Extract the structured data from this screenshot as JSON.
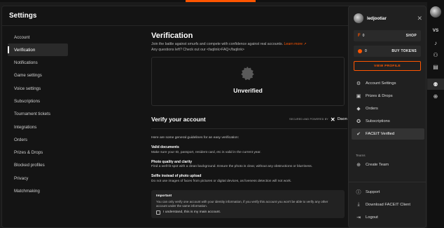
{
  "settings": {
    "title": "Settings",
    "nav": [
      {
        "label": "Account"
      },
      {
        "label": "Verification",
        "active": true
      },
      {
        "label": "Notifications"
      },
      {
        "label": "Game settings"
      },
      {
        "label": "Voice settings"
      },
      {
        "label": "Subscriptions"
      },
      {
        "label": "Tournament tickets"
      },
      {
        "label": "Integrations"
      },
      {
        "label": "Orders"
      },
      {
        "label": "Prizes & Drops"
      },
      {
        "label": "Blocked profiles"
      },
      {
        "label": "Privacy"
      },
      {
        "label": "Matchmaking"
      }
    ]
  },
  "verification": {
    "heading": "Verification",
    "lead_line1": "Join the battle against smurfs and compete with confidence against real accounts.",
    "learn_more": "Learn more ↗",
    "lead_line2": "Any questions left? Check out our <faqlink>FAQ</faqlink>",
    "status": "Unverified",
    "badge_icon": "verified-badge-icon"
  },
  "verify": {
    "heading": "Verify your account",
    "secured_label": "SECURED AND POWERED BY",
    "brand": "Daon",
    "intro": "Here are some general guidelines for an easy verification:",
    "guidelines": [
      {
        "title": "Valid documents",
        "text": "Make sure your ID, passport, resident card, etc is valid in the current year."
      },
      {
        "title": "Photo quality and clarity",
        "text": "Find a well-lit spot with a clean background. Ensure the photo is clear, without any obstructions or blurriness."
      },
      {
        "title": "Selfie instead of photo upload",
        "text": "Do not use images of faces from pictures or digital devices, as liveness detection will not work."
      }
    ],
    "important": {
      "title": "Important",
      "text": "You can only verify one account with your identity information, if you verify this account you won't be able to verify any other account under the same information.",
      "checkbox_label": "I understand, this is my main account."
    }
  },
  "menu": {
    "username": "ledjootiar",
    "points": {
      "amount": "0",
      "action": "SHOP"
    },
    "tokens": {
      "amount": "0",
      "action": "BUY TOKENS"
    },
    "view_profile": "VIEW PROFILE",
    "items": [
      {
        "label": "Account Settings",
        "icon": "gear-icon"
      },
      {
        "label": "Prizes & Drops",
        "icon": "gift-icon"
      },
      {
        "label": "Orders",
        "icon": "tag-icon"
      },
      {
        "label": "Subscriptions",
        "icon": "subscription-icon"
      },
      {
        "label": "FACEIT Verified",
        "icon": "verified-icon",
        "active": true
      }
    ],
    "teams_label": "Teams",
    "create_team": "Create Team",
    "bottom": [
      {
        "label": "Support",
        "icon": "info-icon"
      },
      {
        "label": "Download FACEIT Client",
        "icon": "download-icon"
      },
      {
        "label": "Logout",
        "icon": "logout-icon"
      }
    ]
  },
  "rail": {
    "vs_label": "VS"
  },
  "colors": {
    "accent": "#ff5500",
    "background": "#141414",
    "panel": "#202020"
  }
}
